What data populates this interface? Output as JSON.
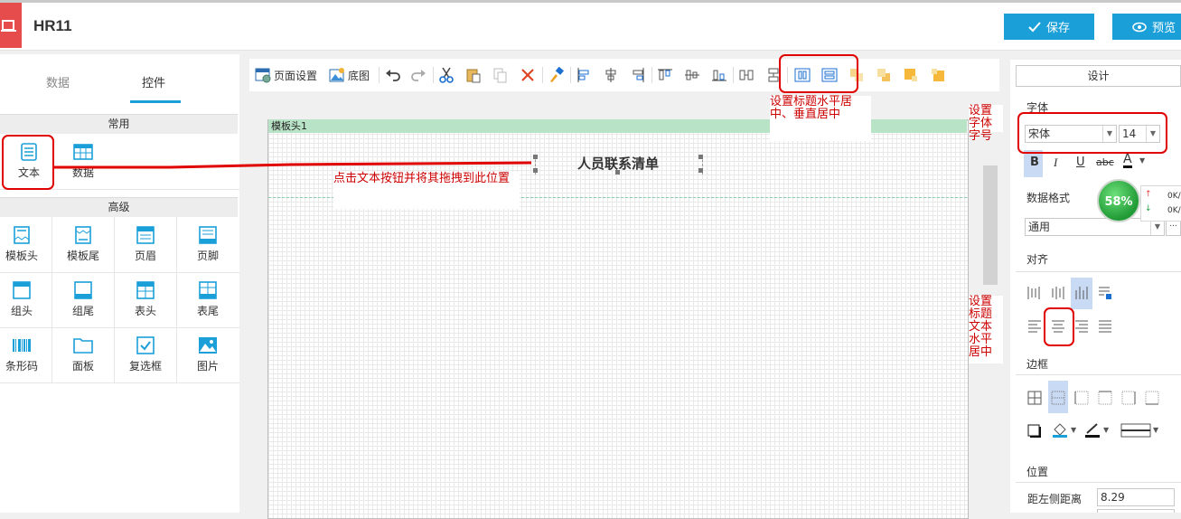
{
  "header": {
    "app_title": "HR11",
    "save_label": "保存",
    "preview_label": "预览"
  },
  "left_panel": {
    "tabs": [
      {
        "label": "数据"
      },
      {
        "label": "控件"
      }
    ],
    "common_section": "常用",
    "common_items": [
      {
        "label": "文本",
        "icon": "text-icon"
      },
      {
        "label": "数据",
        "icon": "table-icon"
      }
    ],
    "advanced_section": "高级",
    "advanced_items": [
      {
        "label": "模板头",
        "icon": "template-header-icon"
      },
      {
        "label": "模板尾",
        "icon": "template-footer-icon"
      },
      {
        "label": "页眉",
        "icon": "page-header-icon"
      },
      {
        "label": "页脚",
        "icon": "page-footer-icon"
      },
      {
        "label": "组头",
        "icon": "group-header-icon"
      },
      {
        "label": "组尾",
        "icon": "group-footer-icon"
      },
      {
        "label": "表头",
        "icon": "table-header-icon"
      },
      {
        "label": "表尾",
        "icon": "table-footer-icon"
      },
      {
        "label": "条形码",
        "icon": "barcode-icon"
      },
      {
        "label": "面板",
        "icon": "panel-icon"
      },
      {
        "label": "复选框",
        "icon": "checkbox-icon"
      },
      {
        "label": "图片",
        "icon": "image-icon"
      }
    ]
  },
  "toolbar": {
    "page_setup": "页面设置",
    "background": "底图"
  },
  "canvas": {
    "band_label": "模板头1",
    "title_text": "人员联系清单"
  },
  "right_panel": {
    "design_tab": "设计",
    "font_label": "字体",
    "font_family": "宋体",
    "font_size": "14",
    "format_label": "数据格式",
    "format_value": "通用",
    "align_label": "对齐",
    "border_label": "边框",
    "position_label": "位置",
    "left_distance_label": "距左侧距离",
    "left_distance_value": "8.29"
  },
  "annotations": {
    "drag_hint": "点击文本按钮并将其拖拽到此位置",
    "center_hint": "设置标题水平居中、垂直居中",
    "font_hint": "设置字体字号",
    "text_align_hint": "设置标题文本水平居中"
  },
  "monitor": {
    "percent": "58%",
    "up": "0K/",
    "down": "0K/"
  },
  "colors": {
    "accent": "#1a9fd9",
    "annotation": "#cc0000",
    "band": "#b9e3c6",
    "logo": "#e64c4c"
  }
}
